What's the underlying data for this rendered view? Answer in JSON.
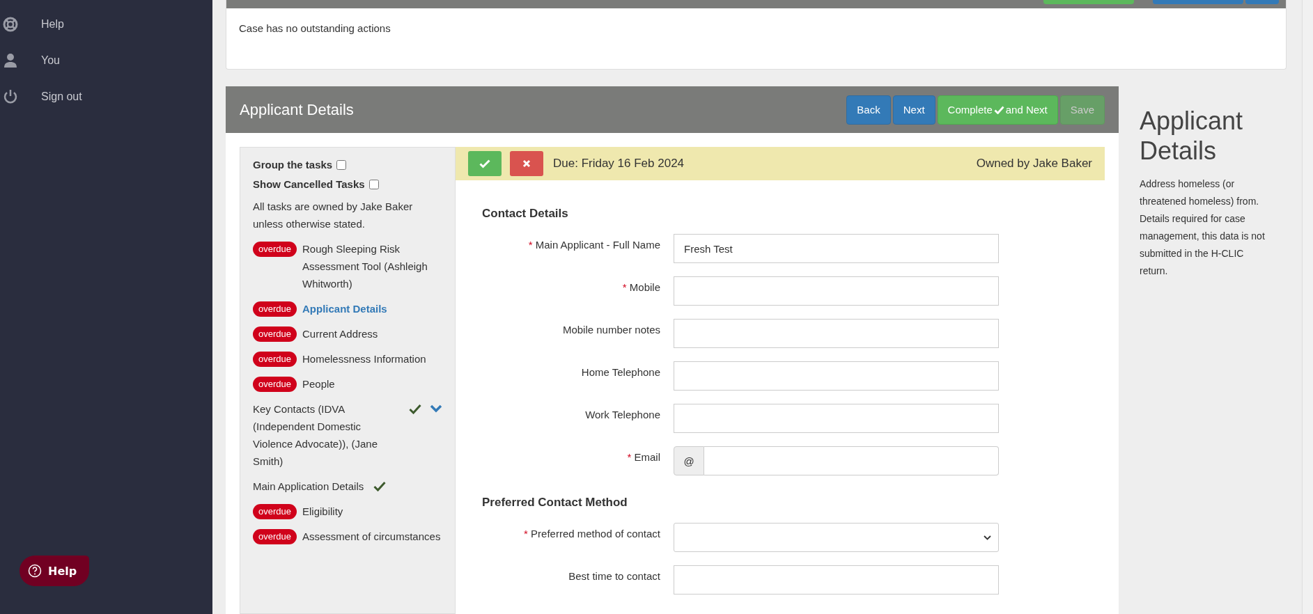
{
  "sidebar": {
    "items": [
      {
        "label": "Help"
      },
      {
        "label": "You"
      },
      {
        "label": "Sign out"
      }
    ],
    "help_button": "Help"
  },
  "case_card": {
    "header_buttons": [
      {
        "kind": "success"
      },
      {
        "kind": "primary"
      },
      {
        "kind": "primary"
      }
    ],
    "message": "Case has no outstanding actions"
  },
  "panel": {
    "title": "Applicant Details",
    "buttons": [
      {
        "label": "Back",
        "kind": "primary",
        "disabled": false
      },
      {
        "label": "Next",
        "kind": "primary",
        "disabled": false
      },
      {
        "label": "Complete",
        "label_after": "and Next",
        "kind": "complete",
        "disabled": false
      },
      {
        "label": "Save",
        "kind": "success",
        "disabled": true
      }
    ]
  },
  "tasks": {
    "options": [
      {
        "label": "Group the tasks",
        "checked": false
      },
      {
        "label": "Show Cancelled Tasks",
        "checked": false
      }
    ],
    "note": "All tasks are owned by Jake Baker unless otherwise stated.",
    "items": [
      {
        "label": "Rough Sleeping Risk Assessment Tool (Ashleigh Whitworth)",
        "overdue": true,
        "completed": false,
        "selected": false,
        "badge": "overdue"
      },
      {
        "label": "Applicant Details",
        "overdue": true,
        "completed": false,
        "selected": true,
        "badge": "overdue"
      },
      {
        "label": "Current Address",
        "overdue": true,
        "completed": false,
        "selected": false,
        "badge": "overdue"
      },
      {
        "label": "Homelessness Information",
        "overdue": true,
        "completed": false,
        "selected": false,
        "badge": "overdue"
      },
      {
        "label": "People",
        "overdue": true,
        "completed": false,
        "selected": false,
        "badge": "overdue"
      },
      {
        "label": "Key Contacts (IDVA (Independent Domestic Violence Advocate)), (Jane Smith)",
        "overdue": false,
        "completed": true,
        "selected": false,
        "expanded": false
      },
      {
        "label": "Main Application Details",
        "overdue": false,
        "completed": true,
        "selected": false
      },
      {
        "label": "Eligibility",
        "overdue": true,
        "completed": false,
        "selected": false,
        "badge": "overdue"
      },
      {
        "label": "Assessment of circumstances",
        "overdue": true,
        "completed": false,
        "selected": false,
        "badge": "overdue"
      }
    ]
  },
  "task_bar": {
    "due": "Due: Friday 16 Feb 2024",
    "owner": "Owned by Jake Baker"
  },
  "form": {
    "sections": [
      {
        "heading": "Contact Details",
        "fields": [
          {
            "label": "Main Applicant - Full Name",
            "required_mark": "*",
            "kind": "text",
            "value": "Fresh Test"
          },
          {
            "label": "Mobile",
            "required_mark": "*",
            "kind": "text"
          },
          {
            "label": "Mobile number notes",
            "kind": "text"
          },
          {
            "label": "Home Telephone",
            "kind": "text"
          },
          {
            "label": "Work Telephone",
            "kind": "text"
          },
          {
            "label": "Email",
            "required_mark": "*",
            "kind": "email",
            "addon": "@"
          }
        ]
      },
      {
        "heading": "Preferred Contact Method",
        "fields": [
          {
            "label": "Preferred method of contact",
            "required_mark": "*",
            "kind": "select"
          },
          {
            "label": "Best time to contact",
            "kind": "text"
          }
        ]
      }
    ]
  },
  "info": {
    "title": "Applicant Details",
    "text": "Address homeless (or threatened homeless) from. Details required for case management, this data is not submitted in the H-CLIC return."
  }
}
